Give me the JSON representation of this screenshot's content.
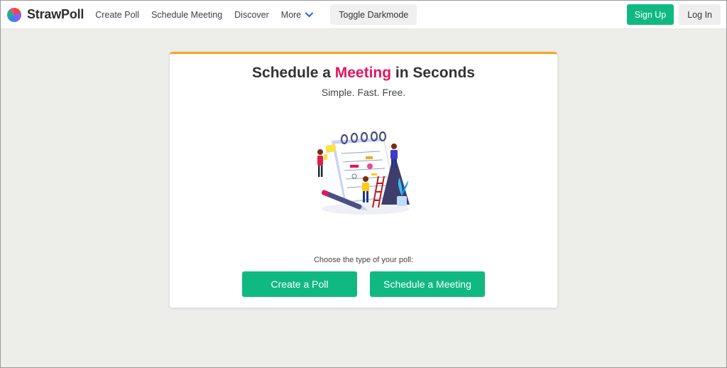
{
  "navbar": {
    "brand": "StrawPoll",
    "links": [
      "Create Poll",
      "Schedule Meeting",
      "Discover"
    ],
    "more_label": "More",
    "toggle_label": "Toggle Darkmode",
    "signup_label": "Sign Up",
    "login_label": "Log In"
  },
  "hero": {
    "title_before": "Schedule a ",
    "title_accent": "Meeting",
    "title_after": " in Seconds",
    "tagline": "Simple. Fast. Free.",
    "choose_text": "Choose the type of your poll:",
    "create_poll_label": "Create a Poll",
    "schedule_meeting_label": "Schedule a Meeting"
  },
  "colors": {
    "accent_green": "#10b981",
    "accent_pink": "#e6145f",
    "card_top_border": "#f5a623",
    "page_bg": "#ededea"
  },
  "icons": [
    "strawpoll-logo-icon",
    "chevron-down-icon",
    "calendar-illustration"
  ]
}
